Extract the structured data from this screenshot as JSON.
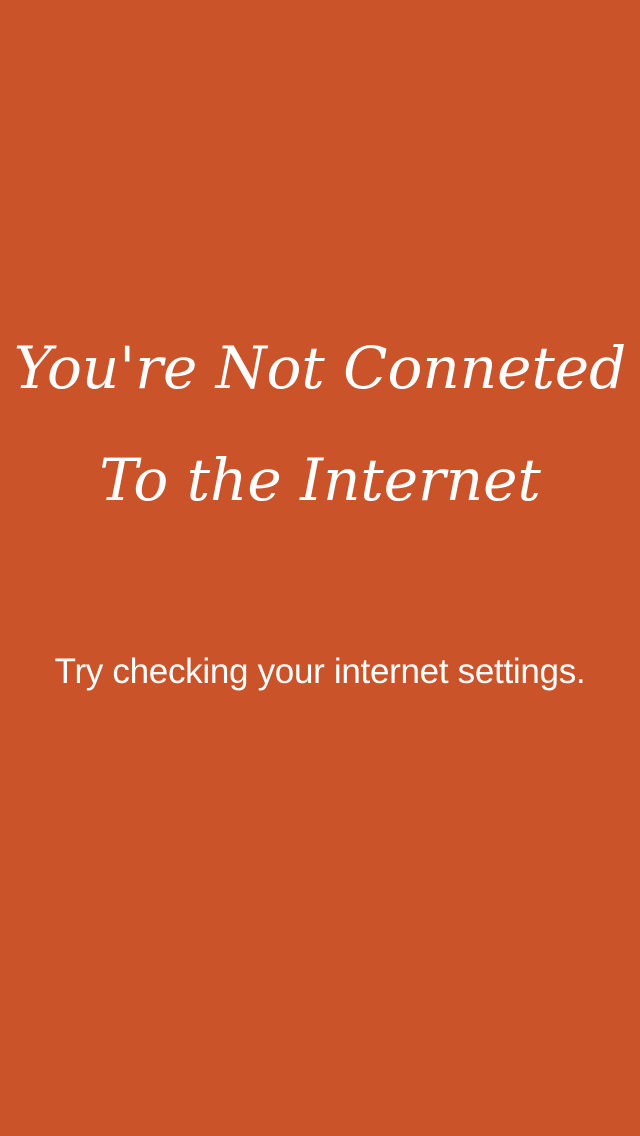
{
  "colors": {
    "background": "#CB532A",
    "text": "#FFFFFF"
  },
  "offline": {
    "headline_line_1": "You're Not Conneted",
    "headline_line_2": "To the Internet",
    "message": "Try checking your internet settings."
  }
}
